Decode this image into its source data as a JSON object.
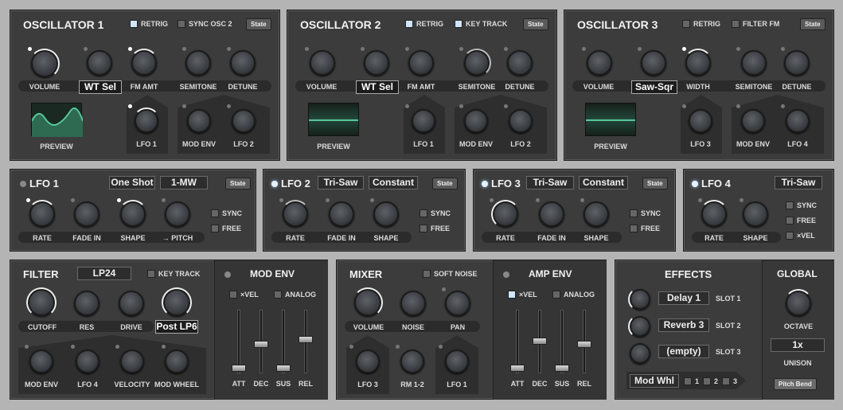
{
  "osc1": {
    "title": "OSCILLATOR 1",
    "opt1": "RETRIG",
    "opt2": "SYNC OSC 2",
    "state": "State",
    "k1": "VOLUME",
    "sel": "WT Sel",
    "k3": "FM AMT",
    "k4": "SEMITONE",
    "k5": "DETUNE",
    "preview": "PREVIEW",
    "m1": "LFO 1",
    "m2": "MOD ENV",
    "m3": "LFO 2"
  },
  "osc2": {
    "title": "OSCILLATOR 2",
    "opt1": "RETRIG",
    "opt2": "KEY TRACK",
    "state": "State",
    "k1": "VOLUME",
    "sel": "WT Sel",
    "k3": "FM AMT",
    "k4": "SEMITONE",
    "k5": "DETUNE",
    "preview": "PREVIEW",
    "m1": "LFO 1",
    "m2": "MOD ENV",
    "m3": "LFO 2"
  },
  "osc3": {
    "title": "OSCILLATOR 3",
    "opt1": "RETRIG",
    "opt2": "FILTER FM",
    "state": "State",
    "k1": "VOLUME",
    "sel": "Saw-Sqr",
    "k3": "WIDTH",
    "k4": "SEMITONE",
    "k5": "DETUNE",
    "preview": "PREVIEW",
    "m1": "LFO 3",
    "m2": "MOD ENV",
    "m3": "LFO 4"
  },
  "lfo1": {
    "title": "LFO 1",
    "shape": "One Shot",
    "mode": "1-MW",
    "state": "State",
    "k1": "RATE",
    "k2": "FADE IN",
    "k3": "SHAPE",
    "k4": "→ PITCH",
    "sync": "SYNC",
    "free": "FREE"
  },
  "lfo2": {
    "title": "LFO 2",
    "shape": "Tri-Saw",
    "mode": "Constant",
    "state": "State",
    "k1": "RATE",
    "k2": "FADE IN",
    "k3": "SHAPE",
    "sync": "SYNC",
    "free": "FREE"
  },
  "lfo3": {
    "title": "LFO 3",
    "shape": "Tri-Saw",
    "mode": "Constant",
    "state": "State",
    "k1": "RATE",
    "k2": "FADE IN",
    "k3": "SHAPE",
    "sync": "SYNC",
    "free": "FREE"
  },
  "lfo4": {
    "title": "LFO 4",
    "shape": "Tri-Saw",
    "k1": "RATE",
    "k2": "SHAPE",
    "sync": "SYNC",
    "free": "FREE",
    "vel": "×VEL"
  },
  "filter": {
    "title": "FILTER",
    "type": "LP24",
    "keytrack": "KEY TRACK",
    "k1": "CUTOFF",
    "k2": "RES",
    "k3": "DRIVE",
    "post": "Post LP6",
    "m1": "MOD ENV",
    "m2": "LFO 4",
    "m3": "VELOCITY",
    "m4": "MOD WHEEL"
  },
  "modenv": {
    "title": "MOD ENV",
    "vel": "×VEL",
    "analog": "ANALOG",
    "att": "ATT",
    "dec": "DEC",
    "sus": "SUS",
    "rel": "REL"
  },
  "mixer": {
    "title": "MIXER",
    "softnoise": "SOFT NOISE",
    "k1": "VOLUME",
    "k2": "NOISE",
    "k3": "PAN",
    "m1": "LFO 3",
    "m2": "RM 1-2",
    "m3": "LFO 1"
  },
  "ampenv": {
    "title": "AMP ENV",
    "vel": "×VEL",
    "analog": "ANALOG",
    "att": "ATT",
    "dec": "DEC",
    "sus": "SUS",
    "rel": "REL"
  },
  "effects": {
    "title": "EFFECTS",
    "fx1": "Delay 1",
    "s1": "SLOT 1",
    "fx2": "Reverb 3",
    "s2": "SLOT 2",
    "fx3": "(empty)",
    "s3": "SLOT 3",
    "src": "Mod Whl",
    "c1": "1",
    "c2": "2",
    "c3": "3"
  },
  "global": {
    "title": "GLOBAL",
    "octave": "OCTAVE",
    "unison_val": "1x",
    "unison": "UNISON",
    "pb": "Pitch Bend"
  },
  "colors": {
    "panel": "#3c3c3c",
    "accent": "#cfe6ff",
    "wave": "#59c79a"
  }
}
